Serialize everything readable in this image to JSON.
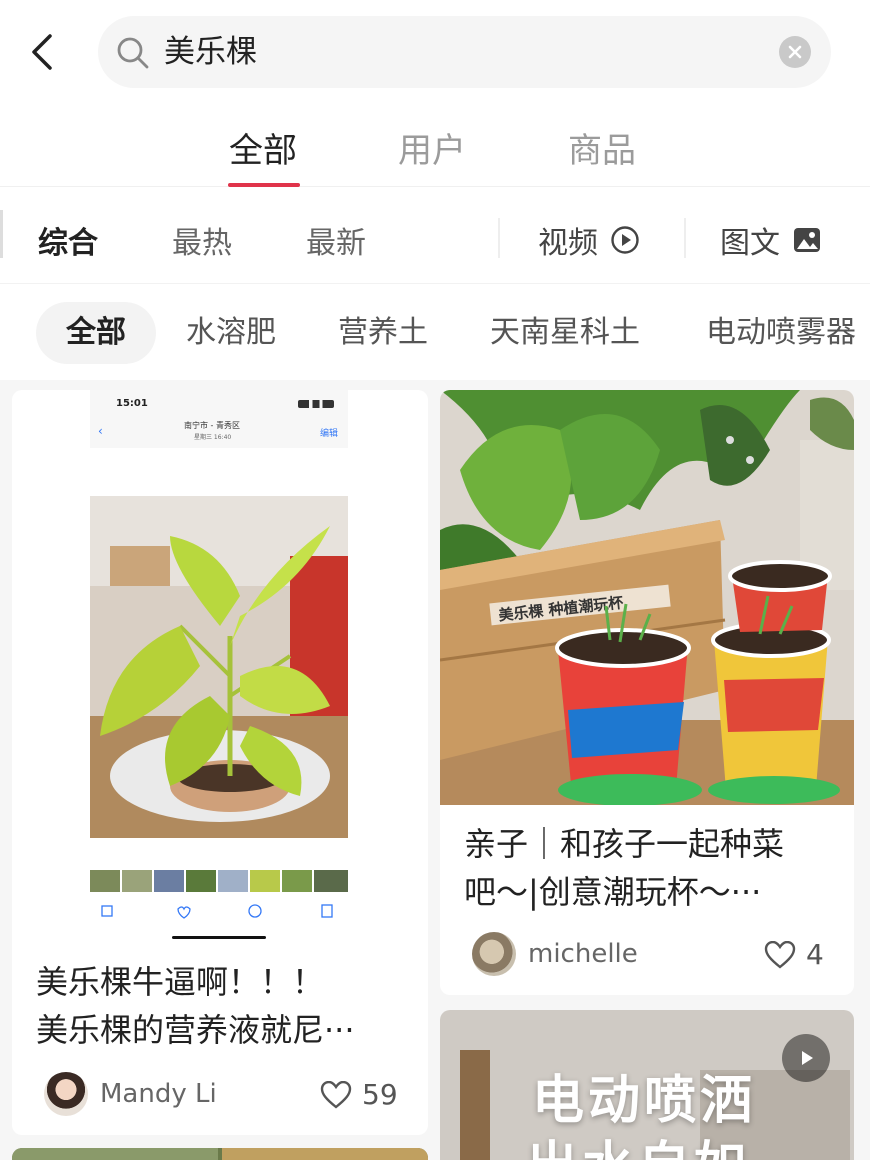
{
  "search": {
    "query": "美乐棵",
    "icons": {
      "back": "back-chevron-icon",
      "search": "search-icon",
      "clear": "clear-icon"
    }
  },
  "main_tabs": [
    {
      "label": "全部",
      "active": true
    },
    {
      "label": "用户",
      "active": false
    },
    {
      "label": "商品",
      "active": false
    }
  ],
  "sort_options": [
    {
      "label": "综合",
      "active": true
    },
    {
      "label": "最热",
      "active": false
    },
    {
      "label": "最新",
      "active": false
    }
  ],
  "content_modes": [
    {
      "label": "视频",
      "icon": "play-circle-icon"
    },
    {
      "label": "图文",
      "icon": "image-icon"
    }
  ],
  "filter_chips": [
    {
      "label": "全部",
      "active": true
    },
    {
      "label": "水溶肥",
      "active": false
    },
    {
      "label": "营养土",
      "active": false
    },
    {
      "label": "天南星科土",
      "active": false
    },
    {
      "label": "电动喷雾器",
      "active": false
    }
  ],
  "cards": [
    {
      "title_line1": "美乐棵牛逼啊！！！",
      "title_line2": "美乐棵的营养液就尼···",
      "author": "Mandy Li",
      "likes": "59",
      "screenshot": {
        "time": "15:01",
        "location": "南宁市 - 青秀区",
        "date": "星期三 16:40",
        "edit": "编辑"
      }
    },
    {
      "title_line1": "亲子｜和孩子一起种菜",
      "title_line2": "吧～|创意潮玩杯～···",
      "author": "michelle",
      "likes": "4",
      "image_banner": "美乐棵 种植潮玩杯"
    },
    {
      "overlay_line1": "电动喷洒",
      "overlay_line2": "出水自如",
      "is_video": true
    }
  ],
  "colors": {
    "accent": "#e0334a",
    "chip_bg": "#f3f3f3",
    "search_bg": "#f5f5f5"
  }
}
